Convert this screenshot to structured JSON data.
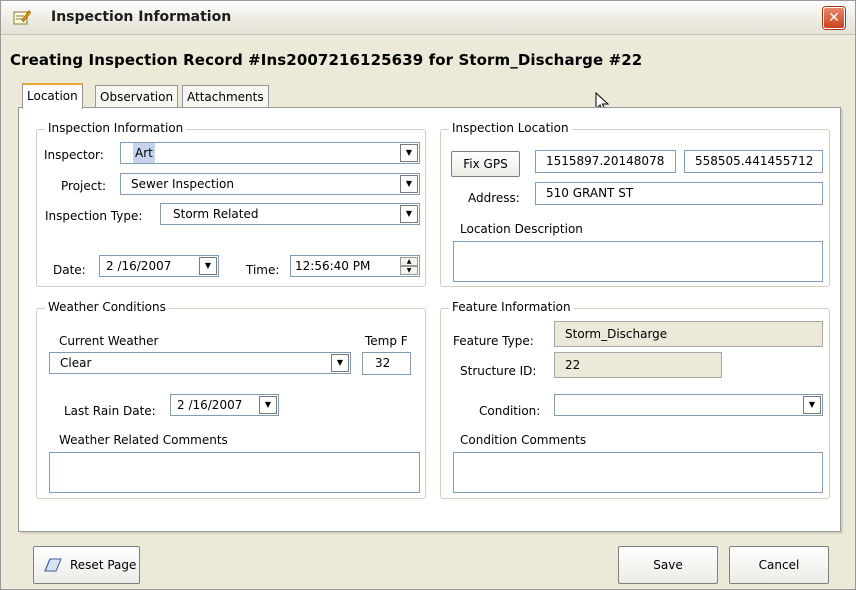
{
  "window": {
    "title": "Inspection Information",
    "close_label": "✕",
    "heading": "Creating Inspection Record #Ins2007216125639 for Storm_Discharge #22"
  },
  "tabs": [
    {
      "label": "Location",
      "active": true
    },
    {
      "label": "Observation",
      "active": false
    },
    {
      "label": "Attachments",
      "active": false
    }
  ],
  "inspection_info": {
    "title": "Inspection Information",
    "inspector_label": "Inspector:",
    "inspector_value": "Art",
    "project_label": "Project:",
    "project_value": "Sewer Inspection",
    "type_label": "Inspection Type:",
    "type_value": "Storm Related",
    "date_label": "Date:",
    "date_value": "2 /16/2007",
    "time_label": "Time:",
    "time_value": "12:56:40 PM"
  },
  "inspection_location": {
    "title": "Inspection Location",
    "fix_gps_label": "Fix GPS",
    "x_value": "1515897.20148078",
    "y_value": "558505.441455712",
    "address_label": "Address:",
    "address_value": "510 GRANT ST",
    "description_label": "Location Description",
    "description_value": ""
  },
  "weather": {
    "title": "Weather Conditions",
    "current_label": "Current Weather",
    "current_value": "Clear",
    "temp_label": "Temp F",
    "temp_value": "32",
    "last_rain_label": "Last Rain Date:",
    "last_rain_value": "2 /16/2007",
    "comments_label": "Weather Related Comments",
    "comments_value": ""
  },
  "feature": {
    "title": "Feature Information",
    "type_label": "Feature Type:",
    "type_value": "Storm_Discharge",
    "structure_label": "Structure ID:",
    "structure_value": "22",
    "condition_label": "Condition:",
    "condition_value": "",
    "comments_label": "Condition Comments",
    "comments_value": ""
  },
  "footer": {
    "reset_label": "Reset Page",
    "save_label": "Save",
    "cancel_label": "Cancel"
  },
  "icons": {
    "title": "form-edit-icon",
    "reset": "eraser-icon",
    "dropdown": "chevron-down-icon",
    "cursor": "mouse-pointer-icon"
  }
}
